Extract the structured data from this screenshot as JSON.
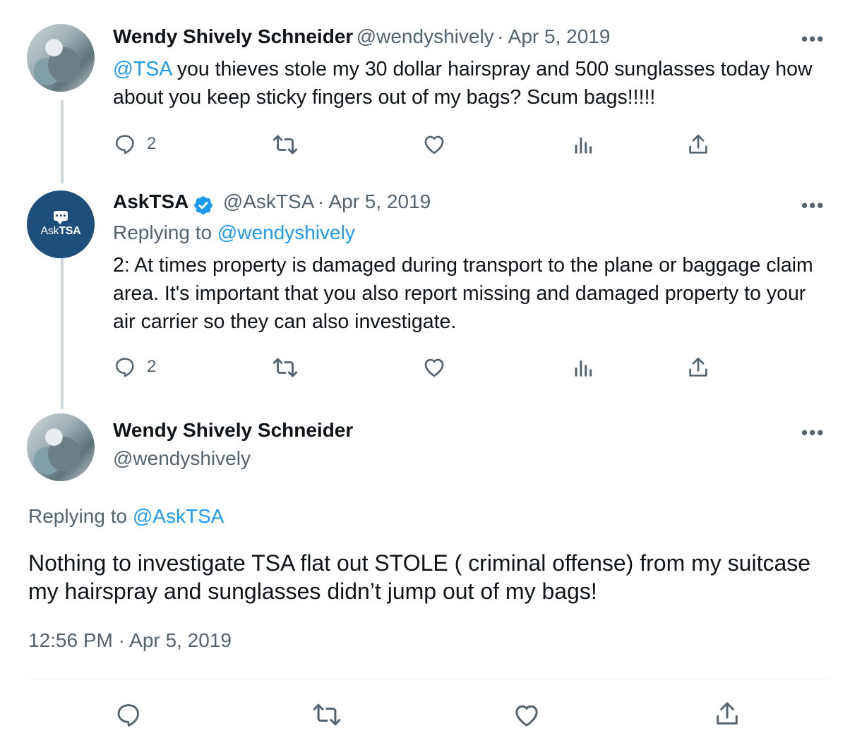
{
  "tweets": [
    {
      "author_name": "Wendy Shively Schneider",
      "handle": "@wendyshively",
      "date": "· Apr 5, 2019",
      "mention": "@TSA",
      "text": " you thieves stole my 30 dollar hairspray and 500 sunglasses today how about you keep sticky fingers out of my bags? Scum bags!!!!!",
      "reply_count": "2"
    },
    {
      "author_name": "AskTSA",
      "handle": "@AskTSA",
      "date": "· Apr 5, 2019",
      "replying_prefix": "Replying to ",
      "replying_handle": "@wendyshively",
      "text": "2: At times property is damaged during transport to the plane or baggage claim area. It's important that you also report missing and damaged property to your air carrier so they can also investigate.",
      "reply_count": "2",
      "avatar_label_light": "Ask",
      "avatar_label_bold": "TSA"
    }
  ],
  "main_tweet": {
    "author_name": "Wendy Shively Schneider",
    "handle": "@wendyshively",
    "replying_prefix": "Replying to ",
    "replying_handle": "@AskTSA",
    "text": "Nothing to investigate TSA flat out STOLE ( criminal offense) from my suitcase my hairspray and sunglasses didn’t jump out of my bags!",
    "timestamp": "12:56 PM · Apr 5, 2019"
  },
  "more_label": "•••",
  "colors": {
    "link": "#1d9bf0",
    "muted": "#536471",
    "thread_line": "#cfd9de",
    "tsa_avatar": "#1e4f7b"
  }
}
